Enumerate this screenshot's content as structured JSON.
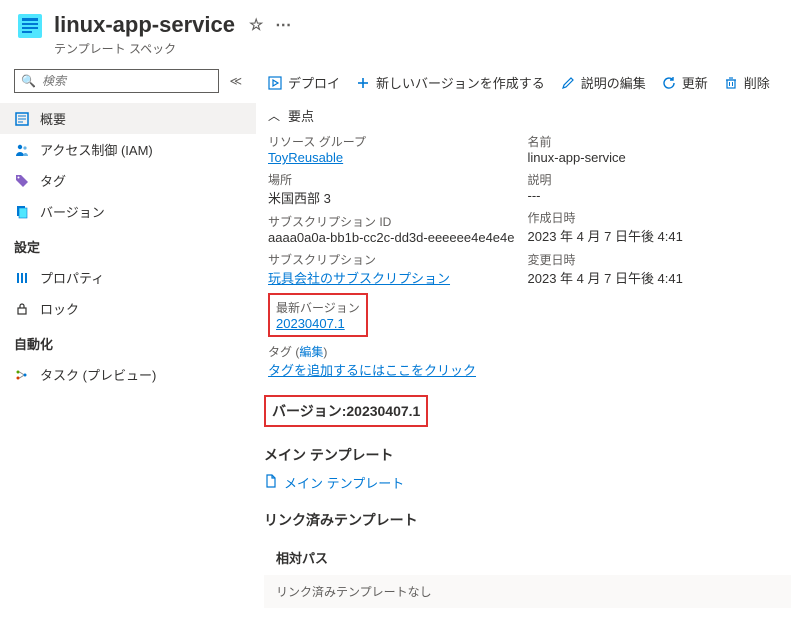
{
  "header": {
    "title": "linux-app-service",
    "subtitle": "テンプレート スペック"
  },
  "sidebar": {
    "search_placeholder": "検索",
    "items": [
      {
        "label": "概要"
      },
      {
        "label": "アクセス制御 (IAM)"
      },
      {
        "label": "タグ"
      },
      {
        "label": "バージョン"
      }
    ],
    "sections": {
      "settings": "設定",
      "automation": "自動化"
    },
    "settings_items": [
      {
        "label": "プロパティ"
      },
      {
        "label": "ロック"
      }
    ],
    "automation_items": [
      {
        "label": "タスク (プレビュー)"
      }
    ]
  },
  "toolbar": {
    "deploy": "デプロイ",
    "new_version": "新しいバージョンを作成する",
    "edit_desc": "説明の編集",
    "refresh": "更新",
    "delete": "削除"
  },
  "essentials": {
    "toggle_label": "要点",
    "left": {
      "rg_label": "リソース グループ",
      "rg_value": "ToyReusable",
      "location_label": "場所",
      "location_value": "米国西部 3",
      "sub_id_label": "サブスクリプション ID",
      "sub_id_value": "aaaa0a0a-bb1b-cc2c-dd3d-eeeeee4e4e4e",
      "sub_label": "サブスクリプション",
      "sub_value": "玩具会社のサブスクリプション",
      "latest_ver_label": "最新バージョン",
      "latest_ver_value": "20230407.1",
      "tags_label": "タグ",
      "tags_edit": "編集",
      "tags_add": "タグを追加するにはここをクリック"
    },
    "right": {
      "name_label": "名前",
      "name_value": "linux-app-service",
      "desc_label": "説明",
      "desc_value": "---",
      "created_label": "作成日時",
      "created_value": "2023 年 4 月 7 日午後 4:41",
      "modified_label": "変更日時",
      "modified_value": "2023 年 4 月 7 日午後 4:41"
    }
  },
  "content": {
    "version_heading": "バージョン:20230407.1",
    "main_template_heading": "メイン テンプレート",
    "main_template_link": "メイン テンプレート",
    "linked_templates_heading": "リンク済みテンプレート",
    "relative_path_label": "相対パス",
    "linked_empty": "リンク済みテンプレートなし"
  }
}
